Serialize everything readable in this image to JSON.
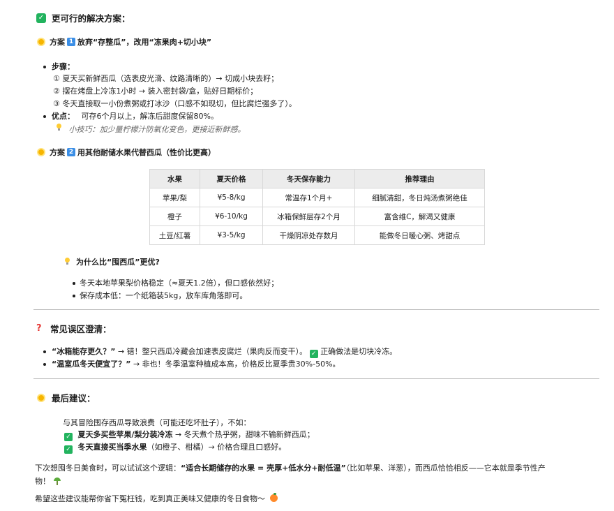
{
  "section1": {
    "title": "更可行的解决方案：",
    "planA": {
      "prefix": "方案",
      "num": "1",
      "title": "放弃“存整瓜”，改用“冻果肉+切小块”"
    },
    "steps": {
      "label": "步骤：",
      "items": [
        "① 夏天买新鲜西瓜（选表皮光滑、纹路清晰的）→ 切成小块去籽；",
        "② 摆在烤盘上冷冻1小时 → 装入密封袋/盒，贴好日期标价；",
        "③ 冬天直接取一小份煮粥或打冰沙（口感不如现切，但比腐烂强多了）。"
      ]
    },
    "pros": {
      "label": "优点：",
      "text": "可存6个月以上，解冻后甜度保留80%。"
    },
    "tip": "小技巧：加少量柠檬汁防氧化变色，更接近新鲜感。",
    "planB": {
      "prefix": "方案",
      "num": "2",
      "title": "用其他耐储水果代替西瓜（性价比更高）"
    },
    "table": {
      "headers": [
        "水果",
        "夏天价格",
        "冬天保存能力",
        "推荐理由"
      ],
      "rows": [
        [
          "苹果/梨",
          "¥5-8/kg",
          "常温存1个月+",
          "细腻清甜，冬日炖汤煮粥绝佳"
        ],
        [
          "橙子",
          "¥6-10/kg",
          "冰箱保鲜层存2个月",
          "富含维C，解渴又健康"
        ],
        [
          "土豆/红薯",
          "¥3-5/kg",
          "干燥阴凉处存数月",
          "能做冬日暖心粥、烤甜点"
        ]
      ]
    },
    "why": {
      "title": "为什么比“囤西瓜”更优?",
      "items": [
        "冬天本地苹果梨价格稳定（≈夏天1.2倍），但口感依然好；",
        "保存成本低：一个纸箱装5kg，放车库角落即可。"
      ]
    }
  },
  "section2": {
    "title": "常见误区澄清：",
    "items": [
      {
        "bold": "“冰箱能存更久？”",
        "text": " → 错！整只西瓜冷藏会加速表皮腐烂（果肉反而变干）。",
        "check_text": "正确做法是切块冷冻。"
      },
      {
        "bold": "“温室瓜冬天便宜了？”",
        "text": " → 非也！冬季温室种植成本高，价格反比夏季贵30%-50%。"
      }
    ]
  },
  "section3": {
    "title": "最后建议：",
    "intro": "与其冒险囤存西瓜导致浪费（可能还吃坏肚子），不如：",
    "items": [
      {
        "bold": "夏天多买些苹果/梨分装冷冻",
        "text": " → 冬天煮个热乎粥，甜味不输新鲜西瓜；"
      },
      {
        "bold": "冬天直接买当季水果",
        "text": "（如橙子、柑橘）→ 价格合理且口感好。"
      }
    ],
    "closing1": "下次想囤冬日美食时，可以试试这个逻辑：",
    "closing_bold": "“适合长期储存的水果 = 壳厚+低水分+耐低温”",
    "closing2": "（比如苹果、洋葱），而西瓜恰恰相反——它本就是季节性产",
    "closing3": "物！",
    "final": "希望这些建议能帮你省下冤枉钱，吃到真正美味又健康的冬日食物～"
  },
  "icons": {
    "check": "check-mark-icon",
    "sun": "sun-icon",
    "bulb": "light-bulb-icon",
    "question": "question-mark-icon",
    "seedling": "seedling-icon",
    "orange": "tangerine-icon"
  },
  "colors": {
    "check": "#22b35e",
    "number_badge": "#3a8ee6",
    "question": "#e53935",
    "divider": "#bdbdbd"
  }
}
